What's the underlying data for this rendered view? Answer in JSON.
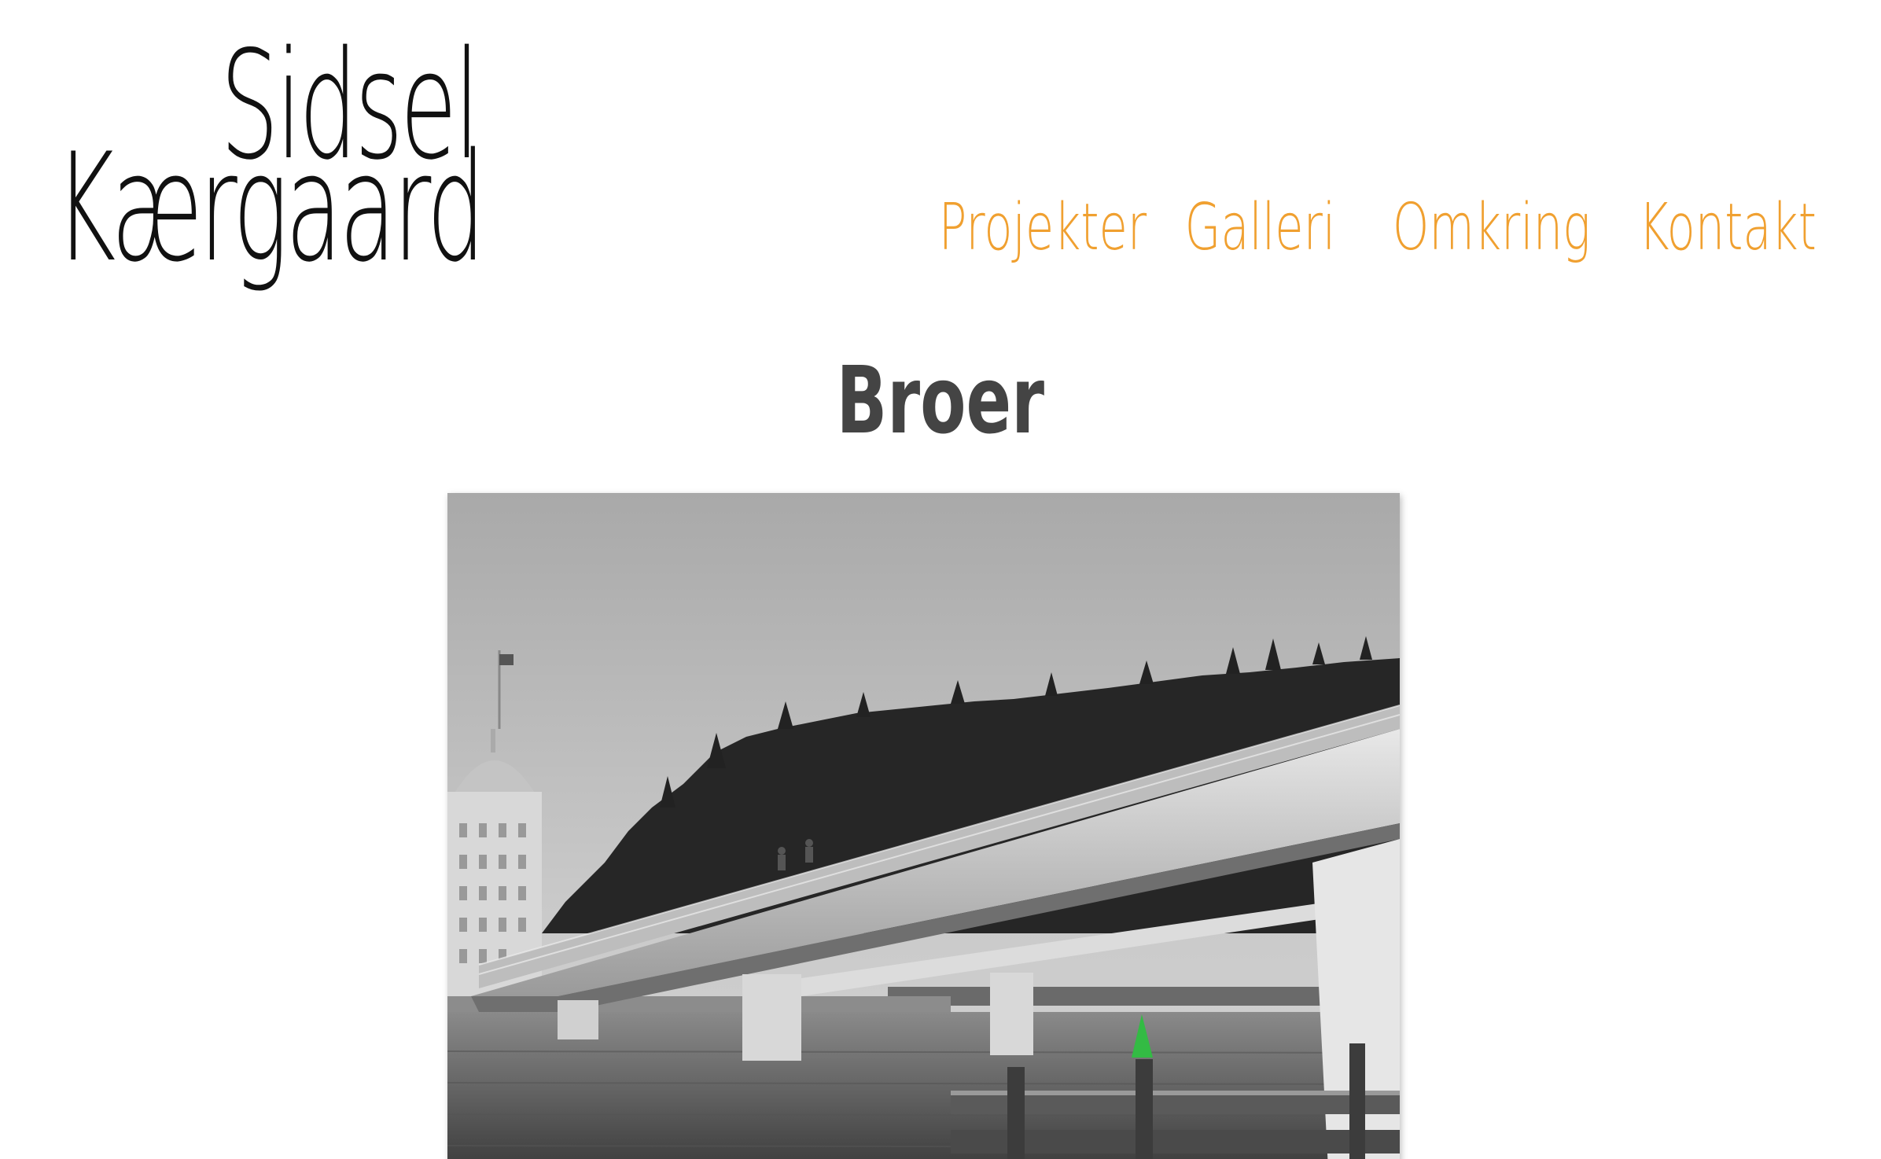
{
  "logo": {
    "line1": "Sidsel",
    "line2": "Kærgaard"
  },
  "nav": {
    "items": [
      {
        "label": "Projekter"
      },
      {
        "label": "Galleri"
      },
      {
        "label": "Omkring"
      },
      {
        "label": "Kontakt"
      }
    ]
  },
  "page": {
    "title": "Broer"
  },
  "photo": {
    "subject": "bridge-photo",
    "accent_color": "#33bb44"
  },
  "colors": {
    "nav": "#f0a030",
    "title": "#444444",
    "logo": "#111111"
  }
}
